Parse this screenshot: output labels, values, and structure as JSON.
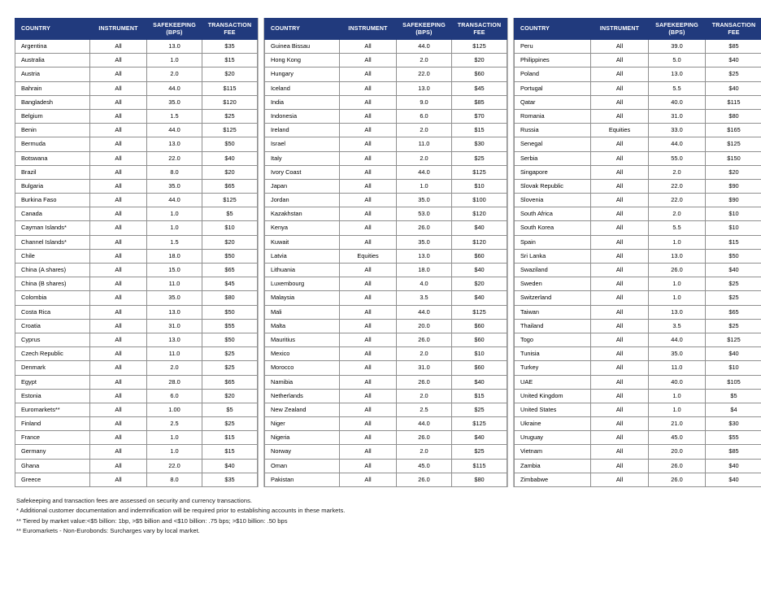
{
  "table": {
    "columns": [
      "COUNTRY",
      "INSTRUMENT",
      "SAFEKEEPING (BPS)",
      "TRANSACTION FEE"
    ],
    "headers": {
      "country": "COUNTRY",
      "instrument": "INSTRUMENT",
      "safekeeping_line1": "SAFEKEEPING",
      "safekeeping_line2": "(BPS)",
      "fee_line1": "TRANSACTION",
      "fee_line2": "FEE"
    },
    "header_bg": "#213a7d",
    "header_fg": "#ffffff",
    "border_color": "#8f8f8f"
  },
  "blocks": [
    {
      "id": "block-left",
      "rows": [
        {
          "country": "Argentina",
          "instrument": "All",
          "safekeeping": "13.0",
          "fee": "$35"
        },
        {
          "country": "Australia",
          "instrument": "All",
          "safekeeping": "1.0",
          "fee": "$15"
        },
        {
          "country": "Austria",
          "instrument": "All",
          "safekeeping": "2.0",
          "fee": "$20"
        },
        {
          "country": "Bahrain",
          "instrument": "All",
          "safekeeping": "44.0",
          "fee": "$115"
        },
        {
          "country": "Bangladesh",
          "instrument": "All",
          "safekeeping": "35.0",
          "fee": "$120"
        },
        {
          "country": "Belgium",
          "instrument": "All",
          "safekeeping": "1.5",
          "fee": "$25"
        },
        {
          "country": "Benin",
          "instrument": "All",
          "safekeeping": "44.0",
          "fee": "$125"
        },
        {
          "country": "Bermuda",
          "instrument": "All",
          "safekeeping": "13.0",
          "fee": "$50"
        },
        {
          "country": "Botswana",
          "instrument": "All",
          "safekeeping": "22.0",
          "fee": "$40"
        },
        {
          "country": "Brazil",
          "instrument": "All",
          "safekeeping": "8.0",
          "fee": "$20"
        },
        {
          "country": "Bulgaria",
          "instrument": "All",
          "safekeeping": "35.0",
          "fee": "$65"
        },
        {
          "country": "Burkina Faso",
          "instrument": "All",
          "safekeeping": "44.0",
          "fee": "$125"
        },
        {
          "country": "Canada",
          "instrument": "All",
          "safekeeping": "1.0",
          "fee": "$5"
        },
        {
          "country": "Cayman Islands*",
          "instrument": "All",
          "safekeeping": "1.0",
          "fee": "$10"
        },
        {
          "country": "Channel Islands*",
          "instrument": "All",
          "safekeeping": "1.5",
          "fee": "$20"
        },
        {
          "country": "Chile",
          "instrument": "All",
          "safekeeping": "18.0",
          "fee": "$50"
        },
        {
          "country": "China (A shares)",
          "instrument": "All",
          "safekeeping": "15.0",
          "fee": "$65"
        },
        {
          "country": "China (B shares)",
          "instrument": "All",
          "safekeeping": "11.0",
          "fee": "$45"
        },
        {
          "country": "Colombia",
          "instrument": "All",
          "safekeeping": "35.0",
          "fee": "$80"
        },
        {
          "country": "Costa Rica",
          "instrument": "All",
          "safekeeping": "13.0",
          "fee": "$50"
        },
        {
          "country": "Croatia",
          "instrument": "All",
          "safekeeping": "31.0",
          "fee": "$55"
        },
        {
          "country": "Cyprus",
          "instrument": "All",
          "safekeeping": "13.0",
          "fee": "$50"
        },
        {
          "country": "Czech Republic",
          "instrument": "All",
          "safekeeping": "11.0",
          "fee": "$25"
        },
        {
          "country": "Denmark",
          "instrument": "All",
          "safekeeping": "2.0",
          "fee": "$25"
        },
        {
          "country": "Egypt",
          "instrument": "All",
          "safekeeping": "28.0",
          "fee": "$65"
        },
        {
          "country": "Estonia",
          "instrument": "All",
          "safekeeping": "6.0",
          "fee": "$20"
        },
        {
          "country": "Euromarkets**",
          "instrument": "All",
          "safekeeping": "1.00",
          "fee": "$5"
        },
        {
          "country": "Finland",
          "instrument": "All",
          "safekeeping": "2.5",
          "fee": "$25"
        },
        {
          "country": "France",
          "instrument": "All",
          "safekeeping": "1.0",
          "fee": "$15"
        },
        {
          "country": "Germany",
          "instrument": "All",
          "safekeeping": "1.0",
          "fee": "$15"
        },
        {
          "country": "Ghana",
          "instrument": "All",
          "safekeeping": "22.0",
          "fee": "$40"
        },
        {
          "country": "Greece",
          "instrument": "All",
          "safekeeping": "8.0",
          "fee": "$35"
        }
      ]
    },
    {
      "id": "block-middle",
      "rows": [
        {
          "country": "Guinea Bissau",
          "instrument": "All",
          "safekeeping": "44.0",
          "fee": "$125"
        },
        {
          "country": "Hong Kong",
          "instrument": "All",
          "safekeeping": "2.0",
          "fee": "$20"
        },
        {
          "country": "Hungary",
          "instrument": "All",
          "safekeeping": "22.0",
          "fee": "$60"
        },
        {
          "country": "Iceland",
          "instrument": "All",
          "safekeeping": "13.0",
          "fee": "$45"
        },
        {
          "country": "India",
          "instrument": "All",
          "safekeeping": "9.0",
          "fee": "$85"
        },
        {
          "country": "Indonesia",
          "instrument": "All",
          "safekeeping": "6.0",
          "fee": "$70"
        },
        {
          "country": "Ireland",
          "instrument": "All",
          "safekeeping": "2.0",
          "fee": "$15"
        },
        {
          "country": "Israel",
          "instrument": "All",
          "safekeeping": "11.0",
          "fee": "$30"
        },
        {
          "country": "Italy",
          "instrument": "All",
          "safekeeping": "2.0",
          "fee": "$25"
        },
        {
          "country": "Ivory Coast",
          "instrument": "All",
          "safekeeping": "44.0",
          "fee": "$125"
        },
        {
          "country": "Japan",
          "instrument": "All",
          "safekeeping": "1.0",
          "fee": "$10"
        },
        {
          "country": "Jordan",
          "instrument": "All",
          "safekeeping": "35.0",
          "fee": "$100"
        },
        {
          "country": "Kazakhstan",
          "instrument": "All",
          "safekeeping": "53.0",
          "fee": "$120"
        },
        {
          "country": "Kenya",
          "instrument": "All",
          "safekeeping": "26.0",
          "fee": "$40"
        },
        {
          "country": "Kuwait",
          "instrument": "All",
          "safekeeping": "35.0",
          "fee": "$120"
        },
        {
          "country": "Latvia",
          "instrument": "Equities",
          "safekeeping": "13.0",
          "fee": "$60"
        },
        {
          "country": "Lithuania",
          "instrument": "All",
          "safekeeping": "18.0",
          "fee": "$40"
        },
        {
          "country": "Luxembourg",
          "instrument": "All",
          "safekeeping": "4.0",
          "fee": "$20"
        },
        {
          "country": "Malaysia",
          "instrument": "All",
          "safekeeping": "3.5",
          "fee": "$40"
        },
        {
          "country": "Mali",
          "instrument": "All",
          "safekeeping": "44.0",
          "fee": "$125"
        },
        {
          "country": "Malta",
          "instrument": "All",
          "safekeeping": "20.0",
          "fee": "$60"
        },
        {
          "country": "Mauritius",
          "instrument": "All",
          "safekeeping": "26.0",
          "fee": "$60"
        },
        {
          "country": "Mexico",
          "instrument": "All",
          "safekeeping": "2.0",
          "fee": "$10"
        },
        {
          "country": "Morocco",
          "instrument": "All",
          "safekeeping": "31.0",
          "fee": "$60"
        },
        {
          "country": "Namibia",
          "instrument": "All",
          "safekeeping": "26.0",
          "fee": "$40"
        },
        {
          "country": "Netherlands",
          "instrument": "All",
          "safekeeping": "2.0",
          "fee": "$15"
        },
        {
          "country": "New Zealand",
          "instrument": "All",
          "safekeeping": "2.5",
          "fee": "$25"
        },
        {
          "country": "Niger",
          "instrument": "All",
          "safekeeping": "44.0",
          "fee": "$125"
        },
        {
          "country": "Nigeria",
          "instrument": "All",
          "safekeeping": "26.0",
          "fee": "$40"
        },
        {
          "country": "Norway",
          "instrument": "All",
          "safekeeping": "2.0",
          "fee": "$25"
        },
        {
          "country": "Oman",
          "instrument": "All",
          "safekeeping": "45.0",
          "fee": "$115"
        },
        {
          "country": "Pakistan",
          "instrument": "All",
          "safekeeping": "26.0",
          "fee": "$80"
        }
      ]
    },
    {
      "id": "block-right",
      "rows": [
        {
          "country": "Peru",
          "instrument": "All",
          "safekeeping": "39.0",
          "fee": "$85"
        },
        {
          "country": "Philippines",
          "instrument": "All",
          "safekeeping": "5.0",
          "fee": "$40"
        },
        {
          "country": "Poland",
          "instrument": "All",
          "safekeeping": "13.0",
          "fee": "$25"
        },
        {
          "country": "Portugal",
          "instrument": "All",
          "safekeeping": "5.5",
          "fee": "$40"
        },
        {
          "country": "Qatar",
          "instrument": "All",
          "safekeeping": "40.0",
          "fee": "$115"
        },
        {
          "country": "Romania",
          "instrument": "All",
          "safekeeping": "31.0",
          "fee": "$80"
        },
        {
          "country": "Russia",
          "instrument": "Equities",
          "safekeeping": "33.0",
          "fee": "$165"
        },
        {
          "country": "Senegal",
          "instrument": "All",
          "safekeeping": "44.0",
          "fee": "$125"
        },
        {
          "country": "Serbia",
          "instrument": "All",
          "safekeeping": "55.0",
          "fee": "$150"
        },
        {
          "country": "Singapore",
          "instrument": "All",
          "safekeeping": "2.0",
          "fee": "$20"
        },
        {
          "country": "Slovak Republic",
          "instrument": "All",
          "safekeeping": "22.0",
          "fee": "$90"
        },
        {
          "country": "Slovenia",
          "instrument": "All",
          "safekeeping": "22.0",
          "fee": "$90"
        },
        {
          "country": "South Africa",
          "instrument": "All",
          "safekeeping": "2.0",
          "fee": "$10"
        },
        {
          "country": "South Korea",
          "instrument": "All",
          "safekeeping": "5.5",
          "fee": "$10"
        },
        {
          "country": "Spain",
          "instrument": "All",
          "safekeeping": "1.0",
          "fee": "$15"
        },
        {
          "country": "Sri Lanka",
          "instrument": "All",
          "safekeeping": "13.0",
          "fee": "$50"
        },
        {
          "country": "Swaziland",
          "instrument": "All",
          "safekeeping": "26.0",
          "fee": "$40"
        },
        {
          "country": "Sweden",
          "instrument": "All",
          "safekeeping": "1.0",
          "fee": "$25"
        },
        {
          "country": "Switzerland",
          "instrument": "All",
          "safekeeping": "1.0",
          "fee": "$25"
        },
        {
          "country": "Taiwan",
          "instrument": "All",
          "safekeeping": "13.0",
          "fee": "$65"
        },
        {
          "country": "Thailand",
          "instrument": "All",
          "safekeeping": "3.5",
          "fee": "$25"
        },
        {
          "country": "Togo",
          "instrument": "All",
          "safekeeping": "44.0",
          "fee": "$125"
        },
        {
          "country": "Tunisia",
          "instrument": "All",
          "safekeeping": "35.0",
          "fee": "$40"
        },
        {
          "country": "Turkey",
          "instrument": "All",
          "safekeeping": "11.0",
          "fee": "$10"
        },
        {
          "country": "UAE",
          "instrument": "All",
          "safekeeping": "40.0",
          "fee": "$105"
        },
        {
          "country": "United Kingdom",
          "instrument": "All",
          "safekeeping": "1.0",
          "fee": "$5"
        },
        {
          "country": "United States",
          "instrument": "All",
          "safekeeping": "1.0",
          "fee": "$4"
        },
        {
          "country": "Ukraine",
          "instrument": "All",
          "safekeeping": "21.0",
          "fee": "$30"
        },
        {
          "country": "Uruguay",
          "instrument": "All",
          "safekeeping": "45.0",
          "fee": "$55"
        },
        {
          "country": "Vietnam",
          "instrument": "All",
          "safekeeping": "20.0",
          "fee": "$85"
        },
        {
          "country": "Zambia",
          "instrument": "All",
          "safekeeping": "26.0",
          "fee": "$40"
        },
        {
          "country": "Zimbabwe",
          "instrument": "All",
          "safekeeping": "26.0",
          "fee": "$40"
        }
      ]
    }
  ],
  "footnotes": [
    "Safekeeping and transaction fees are assessed on security and currency transactions.",
    "* Additional customer documentation and indemnification will be required prior to establishing accounts in these markets.",
    "** Tiered by market value:<$5 billion: 1bp, >$5 billion and <$10 billion: .75 bps; >$10 billion: .50 bps",
    "** Euromarkets - Non-Eurobonds: Surcharges vary by local market."
  ]
}
